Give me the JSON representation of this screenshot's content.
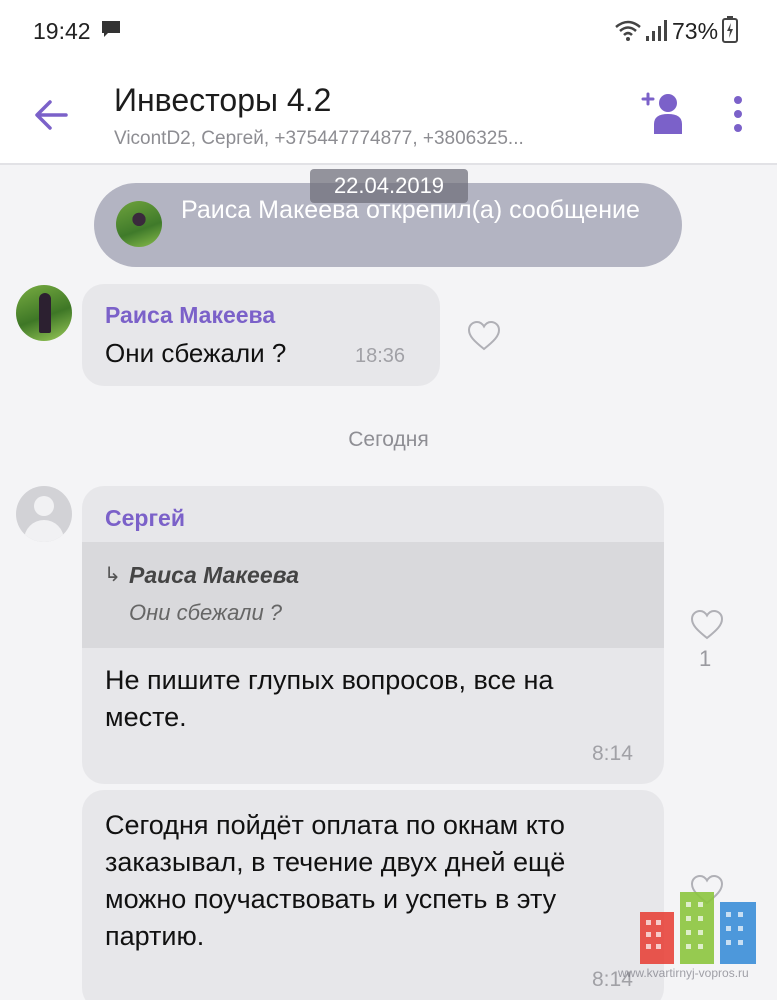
{
  "status_bar": {
    "time": "19:42",
    "battery": "73%"
  },
  "header": {
    "title": "Инвесторы 4.2",
    "subtitle": "ViсontD2, Сергей, +375447774877, +3806325..."
  },
  "system": {
    "date": "22.04.2019",
    "banner_text": "Раиса Макеева открепил(а) сообщение"
  },
  "messages": [
    {
      "sender": "Раиса Макеева",
      "text": "Они сбежали ?",
      "time": "18:36"
    }
  ],
  "day_separator": "Сегодня",
  "sergey_message": {
    "sender": "Сергей",
    "quote_author": "Раиса Макеева",
    "quote_text": "Они сбежали ?",
    "quote_arrow": "↳",
    "text": "Не пишите глупых вопросов, все на месте.",
    "time": "8:14",
    "likes": "1"
  },
  "followup_message": {
    "text": "Сегодня пойдёт оплата по окнам кто заказывал, в течение двух дней ещё можно поучаствовать и успеть в эту партию.",
    "time": "8:14"
  },
  "watermark": {
    "text": "www.kvartirnyj-vopros.ru"
  },
  "colors": {
    "accent": "#7b61c9",
    "bubble": "#e7e7ea",
    "banner": "#b3b4c2"
  },
  "icons": {
    "back": "arrow-left-icon",
    "add_member": "add-member-icon",
    "more": "more-vertical-icon",
    "like": "heart-outline-icon"
  }
}
